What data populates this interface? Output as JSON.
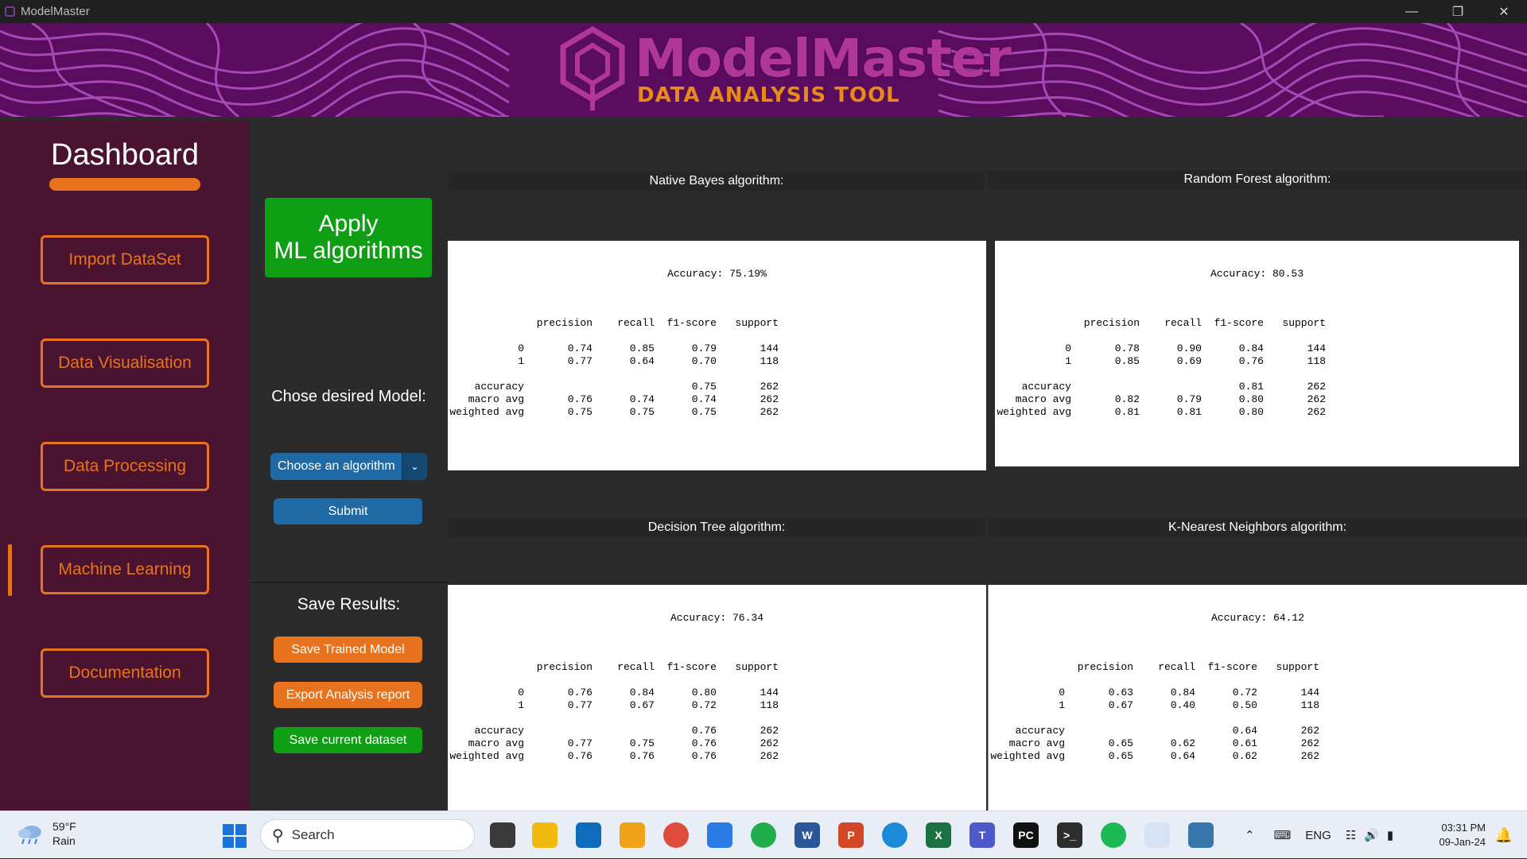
{
  "window": {
    "title": "ModelMaster",
    "minimize": "—",
    "maximize": "❐",
    "close": "✕"
  },
  "banner": {
    "title": "ModelMaster",
    "subtitle": "DATA ANALYSIS TOOL",
    "logo_icon": "hexagon-logo-icon"
  },
  "sidebar": {
    "title": "Dashboard",
    "items": [
      {
        "label": "Import DataSet"
      },
      {
        "label": "Data Visualisation"
      },
      {
        "label": "Data Processing"
      },
      {
        "label": "Machine Learning",
        "active": true
      },
      {
        "label": "Documentation"
      }
    ],
    "accent_color": "#e8731e"
  },
  "controls": {
    "apply_line1": "Apply",
    "apply_line2": "ML algorithms",
    "chose_label": "Chose desired Model:",
    "select_value": "Choose an algorithm",
    "submit_label": "Submit",
    "save_label": "Save Results:",
    "save_model_label": "Save Trained Model",
    "export_label": "Export Analysis report",
    "save_dataset_label": "Save current dataset"
  },
  "results": [
    {
      "title": "Native Bayes algorithm:",
      "accuracy": "Accuracy: 75.19%",
      "header": [
        "",
        "precision",
        "recall",
        "f1-score",
        "support"
      ],
      "rows": [
        [
          "0",
          "0.74",
          "0.85",
          "0.79",
          "144"
        ],
        [
          "1",
          "0.77",
          "0.64",
          "0.70",
          "118"
        ],
        [
          "accuracy",
          "",
          "",
          "0.75",
          "262"
        ],
        [
          "macro avg",
          "0.76",
          "0.74",
          "0.74",
          "262"
        ],
        [
          "weighted avg",
          "0.75",
          "0.75",
          "0.75",
          "262"
        ]
      ]
    },
    {
      "title": "Random Forest algorithm:",
      "accuracy": "Accuracy: 80.53",
      "header": [
        "",
        "precision",
        "recall",
        "f1-score",
        "support"
      ],
      "rows": [
        [
          "0",
          "0.78",
          "0.90",
          "0.84",
          "144"
        ],
        [
          "1",
          "0.85",
          "0.69",
          "0.76",
          "118"
        ],
        [
          "accuracy",
          "",
          "",
          "0.81",
          "262"
        ],
        [
          "macro avg",
          "0.82",
          "0.79",
          "0.80",
          "262"
        ],
        [
          "weighted avg",
          "0.81",
          "0.81",
          "0.80",
          "262"
        ]
      ]
    },
    {
      "title": "Decision Tree algorithm:",
      "accuracy": "Accuracy: 76.34",
      "header": [
        "",
        "precision",
        "recall",
        "f1-score",
        "support"
      ],
      "rows": [
        [
          "0",
          "0.76",
          "0.84",
          "0.80",
          "144"
        ],
        [
          "1",
          "0.77",
          "0.67",
          "0.72",
          "118"
        ],
        [
          "accuracy",
          "",
          "",
          "0.76",
          "262"
        ],
        [
          "macro avg",
          "0.77",
          "0.75",
          "0.76",
          "262"
        ],
        [
          "weighted avg",
          "0.76",
          "0.76",
          "0.76",
          "262"
        ]
      ]
    },
    {
      "title": "K-Nearest Neighbors algorithm:",
      "accuracy": "Accuracy: 64.12",
      "header": [
        "",
        "precision",
        "recall",
        "f1-score",
        "support"
      ],
      "rows": [
        [
          "0",
          "0.63",
          "0.84",
          "0.72",
          "144"
        ],
        [
          "1",
          "0.67",
          "0.40",
          "0.50",
          "118"
        ],
        [
          "accuracy",
          "",
          "",
          "0.64",
          "262"
        ],
        [
          "macro avg",
          "0.65",
          "0.62",
          "0.61",
          "262"
        ],
        [
          "weighted avg",
          "0.65",
          "0.64",
          "0.62",
          "262"
        ]
      ]
    }
  ],
  "taskbar": {
    "weather_temp": "59°F",
    "weather_desc": "Rain",
    "search_placeholder": "Search",
    "language": "ENG",
    "time": "03:31 PM",
    "date": "09-Jan-24",
    "apps": [
      "file-explorer-icon",
      "microsoft-store-icon",
      "snipping-icon",
      "chrome-icon",
      "notepad-icon",
      "whatsapp-icon",
      "word-icon",
      "powerpoint-icon",
      "edge-icon",
      "excel-icon",
      "teams-icon",
      "pycharm-icon",
      "terminal-icon",
      "spotify-icon",
      "python-app-icon",
      "python-icon"
    ]
  }
}
